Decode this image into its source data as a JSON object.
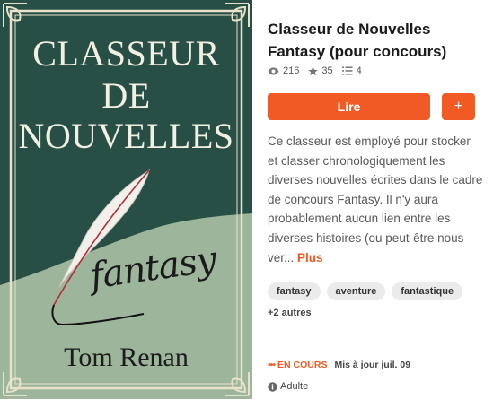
{
  "cover": {
    "title_line1": "CLASSEUR",
    "title_line2": "DE",
    "title_line3": "NOUVELLES",
    "script_word": "fantasy",
    "author": "Tom Renan",
    "colors": {
      "dark_green": "#284f45",
      "sage": "#9db59b",
      "frame": "#e7e2c9"
    }
  },
  "story": {
    "title": "Classeur de Nouvelles Fantasy (pour concours)",
    "stats": {
      "reads": "216",
      "votes": "35",
      "parts": "4"
    },
    "read_label": "Lire",
    "add_label": "+",
    "description": "Ce classeur est employé pour stocker et classer chronologiquement les diverses nouvelles écrites dans le cadre de concours Fantasy. Il n'y aura probablement aucun lien entre les diverses histoires (ou peut-être nous ver...",
    "more_label": "Plus",
    "tags": [
      "fantasy",
      "aventure",
      "fantastique"
    ],
    "more_tags": "+2 autres",
    "status_dots": "•••",
    "status": "EN COURS",
    "updated": "Mis à jour juil. 09",
    "mature_label": "Adulte"
  },
  "accent_color": "#f15a24",
  "icons": [
    "eye-icon",
    "star-icon",
    "list-icon",
    "info-icon"
  ]
}
